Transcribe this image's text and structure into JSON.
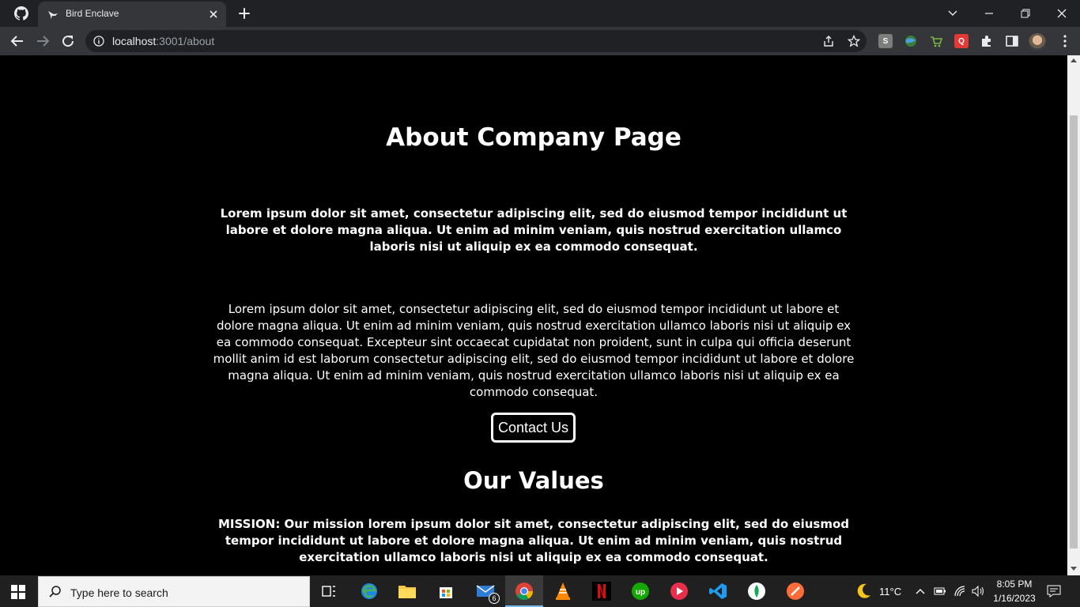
{
  "browser": {
    "tab_title": "Bird Enclave",
    "url_host": "localhost",
    "url_rest": ":3001/about",
    "extensions": [
      "S",
      "Q"
    ]
  },
  "page": {
    "title": "About Company Page",
    "lead": "Lorem ipsum dolor sit amet, consectetur adipiscing elit, sed do eiusmod tempor incididunt ut labore et dolore magna aliqua. Ut enim ad minim veniam, quis nostrud exercitation ullamco laboris nisi ut aliquip ex ea commodo consequat.",
    "body": "Lorem ipsum dolor sit amet, consectetur adipiscing elit, sed do eiusmod tempor incididunt ut labore et dolore magna aliqua. Ut enim ad minim veniam, quis nostrud exercitation ullamco laboris nisi ut aliquip ex ea commodo consequat. Excepteur sint occaecat cupidatat non proident, sunt in culpa qui officia deserunt mollit anim id est laborum consectetur adipiscing elit, sed do eiusmod tempor incididunt ut labore et dolore magna aliqua. Ut enim ad minim veniam, quis nostrud exercitation ullamco laboris nisi ut aliquip ex ea commodo consequat.",
    "contact_button": "Contact Us",
    "values_title": "Our Values",
    "mission": "MISSION: Our mission lorem ipsum dolor sit amet, consectetur adipiscing elit, sed do eiusmod tempor incididunt ut labore et dolore magna aliqua. Ut enim ad minim veniam, quis nostrud exercitation ullamco laboris nisi ut aliquip ex ea commodo consequat."
  },
  "taskbar": {
    "search_placeholder": "Type here to search",
    "mail_badge": "6",
    "weather": "11°C",
    "time": "8:05 PM",
    "date": "1/16/2023"
  },
  "colors": {
    "page_bg": "#000000",
    "chrome_dark": "#202124",
    "chrome_toolbar": "#35363a",
    "taskbar": "#202020"
  }
}
